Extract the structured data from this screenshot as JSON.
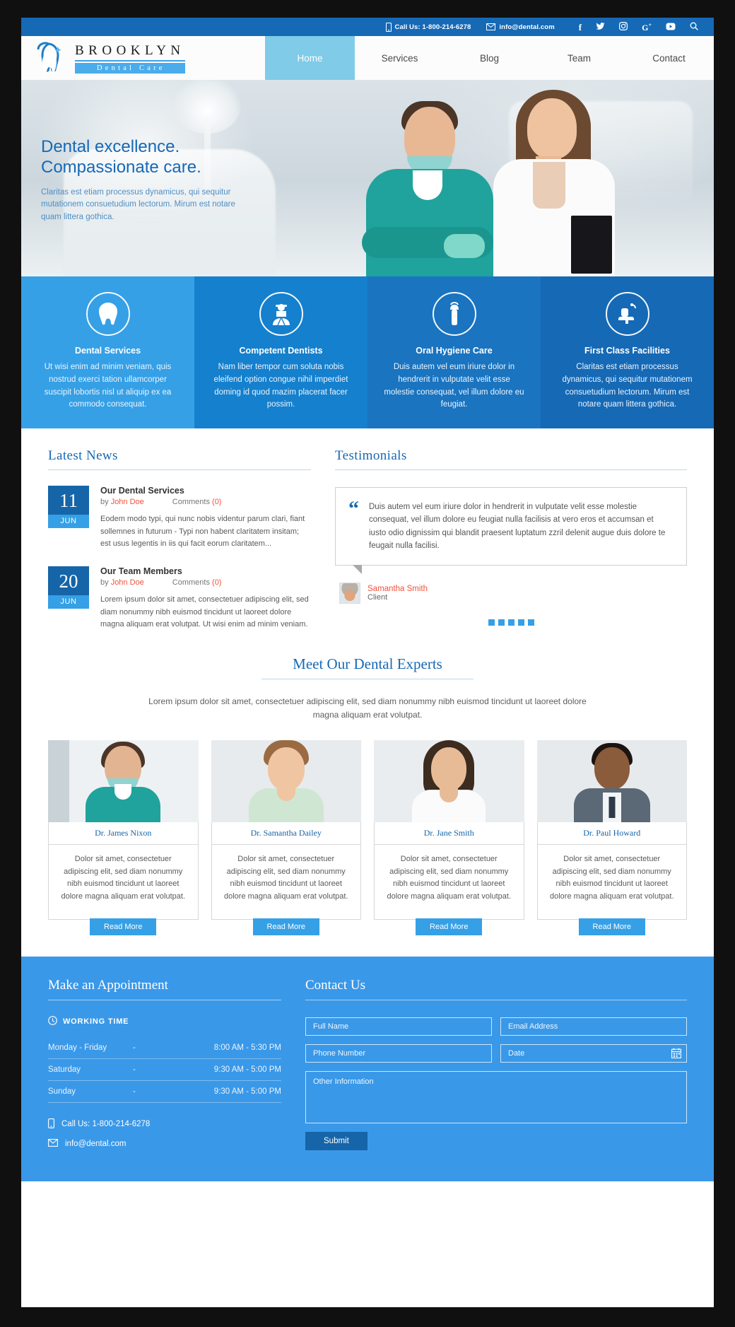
{
  "topbar": {
    "phone_icon": "mobile-icon",
    "phone": "Call Us: 1-800-214-6278",
    "email_icon": "envelope-icon",
    "email": "info@dental.com",
    "social": [
      {
        "name": "facebook-icon",
        "glyph": "f"
      },
      {
        "name": "twitter-icon",
        "glyph": "ᵗ"
      },
      {
        "name": "instagram-icon",
        "glyph": "▣"
      },
      {
        "name": "google-plus-icon",
        "glyph": "G"
      },
      {
        "name": "youtube-icon",
        "glyph": "▶"
      },
      {
        "name": "search-icon",
        "glyph": "⚲"
      }
    ]
  },
  "brand": {
    "name": "BROOKLYN",
    "sub": "Dental Care",
    "logo_icon": "tooth-logo-icon"
  },
  "nav": {
    "items": [
      {
        "label": "Home",
        "active": true
      },
      {
        "label": "Services",
        "active": false
      },
      {
        "label": "Blog",
        "active": false
      },
      {
        "label": "Team",
        "active": false
      },
      {
        "label": "Contact",
        "active": false
      }
    ]
  },
  "hero": {
    "title_line1": "Dental excellence.",
    "title_line2": "Compassionate care.",
    "paragraph": "Claritas est etiam processus dynamicus, qui sequitur mutationem consuetudium lectorum. Mirum est notare quam littera gothica."
  },
  "features": [
    {
      "icon": "tooth-icon",
      "title": "Dental Services",
      "text": "Ut wisi enim ad minim veniam, quis nostrud exerci tation ullamcorper suscipit lobortis nisl ut aliquip ex ea commodo consequat.",
      "color": "#35a0e6"
    },
    {
      "icon": "dentist-icon",
      "title": "Competent Dentists",
      "text": "Nam liber tempor cum soluta nobis eleifend option congue nihil imperdiet doming id quod mazim placerat facer possim.",
      "color": "#1580cd"
    },
    {
      "icon": "toothbrush-icon",
      "title": "Oral Hygiene Care",
      "text": "Duis autem vel eum iriure dolor in hendrerit in vulputate velit esse molestie consequat, vel illum dolore eu feugiat.",
      "color": "#1a74c0"
    },
    {
      "icon": "dental-chair-icon",
      "title": "First Class Facilities",
      "text": "Claritas est etiam processus dynamicus, qui sequitur mutationem consuetudium lectorum. Mirum est notare quam littera gothica.",
      "color": "#1669b5"
    }
  ],
  "news": {
    "title": "Latest News",
    "posts": [
      {
        "day": "11",
        "month": "JUN",
        "title": "Our Dental Services",
        "by_label": "by",
        "author": "John Doe",
        "comments_label": "Comments",
        "comments_count": "(0)",
        "text": "Eodem modo typi, qui nunc nobis videntur parum clari, fiant sollemnes in futurum - Typi non habent claritatem insitam; est usus legentis in iis qui facit eorum claritatem..."
      },
      {
        "day": "20",
        "month": "JUN",
        "title": "Our Team Members",
        "by_label": "by",
        "author": "John Doe",
        "comments_label": "Comments",
        "comments_count": "(0)",
        "text": "Lorem ipsum dolor sit amet, consectetuer adipiscing elit, sed diam nonummy nibh euismod tincidunt ut laoreet dolore magna aliquam erat volutpat. Ut wisi enim ad minim veniam."
      }
    ]
  },
  "testimonials": {
    "title": "Testimonials",
    "quote_mark": "“",
    "quote": "Duis autem vel eum iriure dolor in hendrerit in vulputate velit esse molestie consequat, vel illum dolore eu feugiat nulla facilisis at vero eros et accumsan et iusto odio dignissim qui blandit praesent luptatum zzril delenit augue duis dolore te feugait nulla facilisi.",
    "author_name": "Samantha Smith",
    "author_role": "Client",
    "dots": 5,
    "active_dot": 0
  },
  "team": {
    "title": "Meet Our Dental Experts",
    "subtitle": "Lorem ipsum dolor sit amet, consectetuer adipiscing elit, sed diam nonummy nibh euismod tincidunt ut laoreet dolore magna aliquam erat volutpat.",
    "bio": "Dolor sit amet, consectetuer adipiscing elit, sed diam nonummy nibh euismod tincidunt ut laoreet dolore magna aliquam erat volutpat.",
    "read_more": "Read More",
    "members": [
      {
        "name": "Dr. James Nixon",
        "skin": "#e3b492",
        "hair": "#4a3527",
        "cloth": "#1fa39c",
        "bg": "#e4e9ec"
      },
      {
        "name": "Dr. Samantha Dailey",
        "skin": "#f0c5a2",
        "hair": "#9a6b42",
        "cloth": "#cfe7d2",
        "bg": "#eef1f2"
      },
      {
        "name": "Dr. Jane Smith",
        "skin": "#e8bb97",
        "hair": "#3c2b1f",
        "cloth": "#fbfbfb",
        "bg": "#eceff1"
      },
      {
        "name": "Dr. Paul Howard",
        "skin": "#8a5c3b",
        "hair": "#1c1410",
        "cloth": "#5b6876",
        "bg": "#e9ecef"
      }
    ]
  },
  "appointment": {
    "title": "Make an Appointment",
    "working_time_icon": "clock-icon",
    "working_time_label": "WORKING TIME",
    "hours": [
      {
        "day": "Monday - Friday",
        "dash": "-",
        "time": "8:00 AM - 5:30 PM"
      },
      {
        "day": "Saturday",
        "dash": "-",
        "time": "9:30 AM - 5:00 PM"
      },
      {
        "day": "Sunday",
        "dash": "-",
        "time": "9:30 AM - 5:00 PM"
      }
    ],
    "phone_icon": "mobile-icon",
    "phone": "Call Us: 1-800-214-6278",
    "email_icon": "envelope-icon",
    "email": "info@dental.com"
  },
  "contact": {
    "title": "Contact Us",
    "fields": {
      "full_name": "Full Name",
      "email": "Email Address",
      "phone": "Phone Number",
      "date": "Date",
      "other": "Other Information"
    },
    "date_icon": "calendar-icon",
    "submit": "Submit"
  },
  "colors": {
    "brand_blue": "#1669b5",
    "accent_blue": "#35a0e6",
    "light_blue": "#7fcbe8",
    "footer_blue": "#3a98e8",
    "link_red": "#f0523d"
  }
}
